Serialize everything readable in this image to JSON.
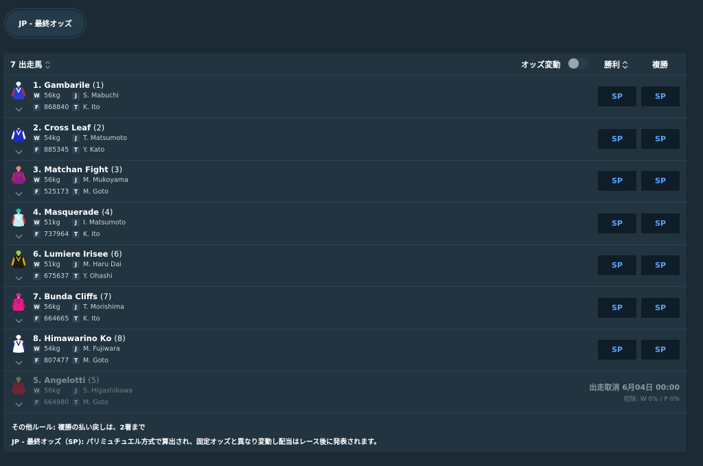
{
  "tab": {
    "label": "JP - 最終オッズ"
  },
  "header": {
    "runner_count": "7 出走馬",
    "odds_movement_label": "オッズ変動",
    "win_label": "勝利",
    "place_label": "複勝"
  },
  "runners": [
    {
      "name": "1. Gambarile",
      "number": "(1)",
      "weight": "56kg",
      "jockey": "S. Mabuchi",
      "form": "868840",
      "trainer": "K. Ito",
      "win_odds": "SP",
      "place_odds": "SP",
      "silk": {
        "body": "#2a3fd0",
        "trim": "#ffffff",
        "cap": "#ffffff",
        "sleeve": "#d2262b"
      }
    },
    {
      "name": "2. Cross Leaf",
      "number": "(2)",
      "weight": "54kg",
      "jockey": "T. Matsumoto",
      "form": "885345",
      "trainer": "Y. Kato",
      "win_odds": "SP",
      "place_odds": "SP",
      "silk": {
        "body": "#1f2bc9",
        "trim": "#ffffff",
        "cap": "#2d2d2d",
        "sleeve": "#ffffff"
      }
    },
    {
      "name": "3. Matchan Fight",
      "number": "(3)",
      "weight": "56kg",
      "jockey": "M. Mukoyama",
      "form": "525173",
      "trainer": "M. Goto",
      "win_odds": "SP",
      "place_odds": "SP",
      "silk": {
        "body": "#8c1f8c",
        "trim": "#c62a4a",
        "cap": "#ff7b7b",
        "sleeve": "#c62a4a"
      }
    },
    {
      "name": "4. Masquerade",
      "number": "(4)",
      "weight": "51kg",
      "jockey": "I. Matsumoto",
      "form": "737964",
      "trainer": "K. Ito",
      "win_odds": "SP",
      "place_odds": "SP",
      "silk": {
        "body": "#bff0f0",
        "trim": "#ffffff",
        "cap": "#17c7c7",
        "sleeve": "#e0343a"
      }
    },
    {
      "name": "6. Lumiere Irisee",
      "number": "(6)",
      "weight": "51kg",
      "jockey": "M. Haru Dai",
      "form": "675637",
      "trainer": "Y. Ohashi",
      "win_odds": "SP",
      "place_odds": "SP",
      "silk": {
        "body": "#1a1a1a",
        "trim": "#e0b400",
        "cap": "#9ed62a",
        "sleeve": "#e0b400"
      }
    },
    {
      "name": "7. Bunda Cliffs",
      "number": "(7)",
      "weight": "56kg",
      "jockey": "T. Morishima",
      "form": "664665",
      "trainer": "K. Ito",
      "win_odds": "SP",
      "place_odds": "SP",
      "silk": {
        "body": "#e0208a",
        "trim": "#b0106a",
        "cap": "#e0208a",
        "sleeve": "#b0106a"
      }
    },
    {
      "name": "8. Himawarino Ko",
      "number": "(8)",
      "weight": "54kg",
      "jockey": "M. Fujiwara",
      "form": "807477",
      "trainer": "M. Goto",
      "win_odds": "SP",
      "place_odds": "SP",
      "silk": {
        "body": "#ffffff",
        "trim": "#1e2fb0",
        "cap": "#ffffff",
        "sleeve": "#1e2fb0"
      }
    }
  ],
  "scratched": {
    "name": "5. Angelotti",
    "number": "(5)",
    "weight": "56kg",
    "jockey": "S. Higashikawa",
    "form": "664980",
    "trainer": "M. Goto",
    "status": "出走取消 6月04日 00:00",
    "deduction": "控除: W 0% / P 0%",
    "silk": {
      "body": "#b01e2e",
      "trim": "#8a1622",
      "cap": "#8fbf3a",
      "sleeve": "#b01e2e"
    }
  },
  "labels": {
    "weight": "W",
    "jockey": "J",
    "form": "F",
    "trainer": "T"
  },
  "footer": {
    "rule": "その他ルール: 複勝の払い戻しは、2着まで",
    "note": "JP - 最終オッズ（SP): パリミュチュエル方式で算出され、固定オッズと異なり変動し配当はレース後に発表されます。"
  }
}
